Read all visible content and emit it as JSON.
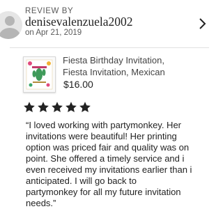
{
  "review": {
    "heading": "REVIEW BY",
    "username": "denisevalenzuela2002",
    "date": "on Apr 21, 2019",
    "rating": 5,
    "rating_max": 5,
    "text_lines": [
      "“I loved working with partymonkey. Her",
      "invitations were beautiful! Her printing",
      "option was priced fair and quality was on",
      "point. She offered a timely service and i",
      "even received my invitations earlier than i",
      "anticipated. I will go back to",
      "partymonkey for all my future invitation",
      "needs.”"
    ]
  },
  "product": {
    "title_lines": [
      "Fiesta Birthday Invitation,",
      "Fiesta Invitation, Mexican"
    ],
    "price": "$16.00"
  },
  "icons": {
    "avatar": "user-avatar-icon",
    "chevron": "chevron-right-icon",
    "star": "star-icon"
  },
  "colors": {
    "star": "#222222",
    "muted_text": "#595959"
  }
}
